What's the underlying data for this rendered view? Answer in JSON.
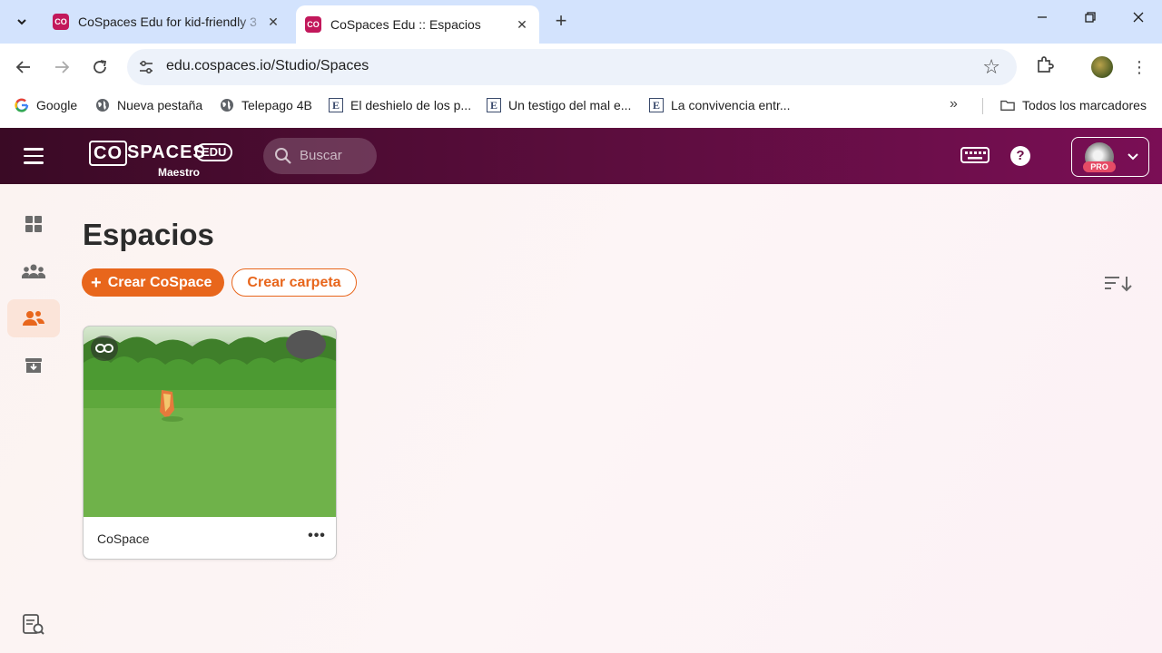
{
  "browser": {
    "tab_search_icon": "chevron-down-icon",
    "tabs": [
      {
        "title": "CoSpaces Edu for kid-friendly 3",
        "favicon": "CO",
        "active": false
      },
      {
        "title": "CoSpaces Edu :: Espacios",
        "favicon": "CO",
        "active": true
      }
    ],
    "url": "edu.cospaces.io/Studio/Spaces",
    "bookmarks": [
      {
        "label": "Google",
        "icon": "google-icon"
      },
      {
        "label": "Nueva pestaña",
        "icon": "globe-icon"
      },
      {
        "label": "Telepago 4B",
        "icon": "globe-icon"
      },
      {
        "label": "El deshielo de los p...",
        "icon": "e-icon"
      },
      {
        "label": "Un testigo del mal e...",
        "icon": "e-icon"
      },
      {
        "label": "La convivencia entr...",
        "icon": "e-icon"
      }
    ],
    "all_bookmarks": "Todos los marcadores"
  },
  "app": {
    "logo": {
      "co": "CO",
      "spaces": "SPACES",
      "edu": "EDU",
      "role": "Maestro"
    },
    "search_placeholder": "Buscar",
    "pro_badge": "PRO",
    "page_title": "Espacios",
    "create_cospace": "Crear CoSpace",
    "create_folder": "Crear carpeta",
    "spaces": [
      {
        "name": "CoSpace",
        "more": "•••"
      }
    ],
    "colors": {
      "accent": "#e8661c",
      "appbar_start": "#3a0a25",
      "appbar_end": "#7a0e55",
      "active_nav_bg": "#fbe4d9"
    }
  }
}
